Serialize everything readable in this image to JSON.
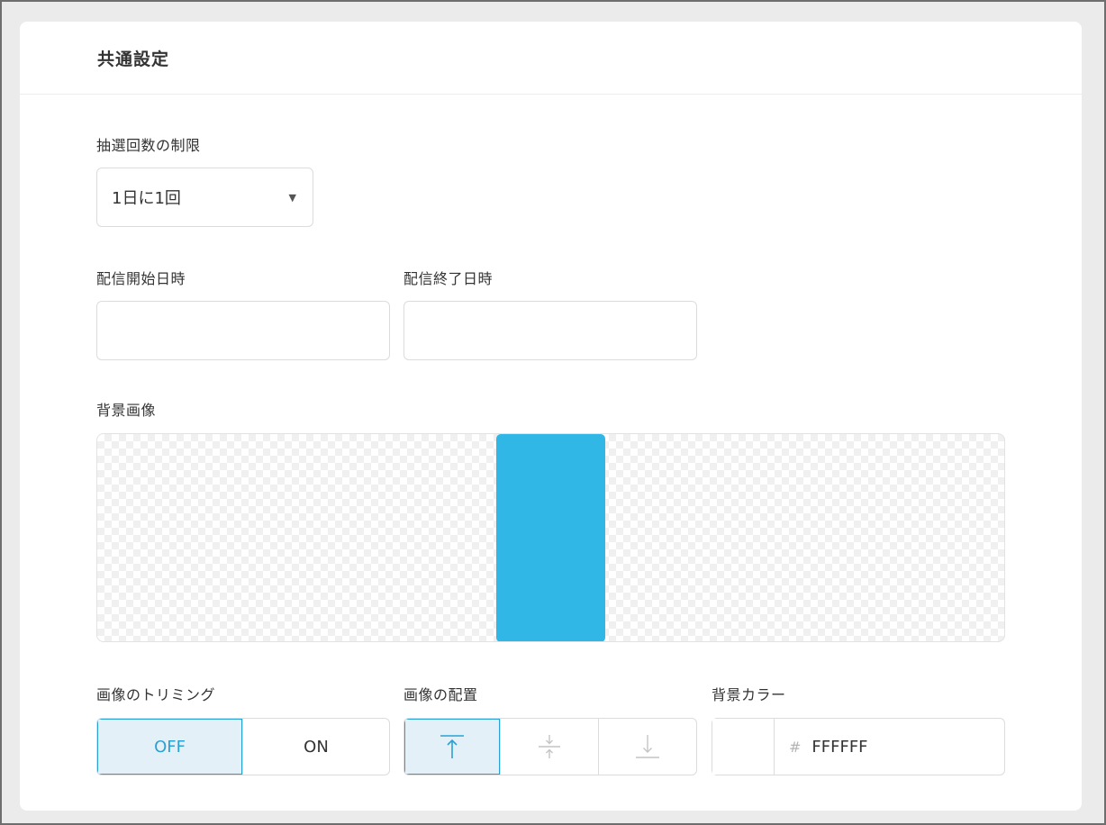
{
  "header": {
    "title": "共通設定"
  },
  "limit": {
    "label": "抽選回数の制限",
    "selected": "1日に1回",
    "caret": "▼"
  },
  "schedule": {
    "start_label": "配信開始日時",
    "start_value": "",
    "end_label": "配信終了日時",
    "end_value": ""
  },
  "background_image": {
    "label": "背景画像",
    "preview_color": "#31b7e6"
  },
  "trimming": {
    "label": "画像のトリミング",
    "options": [
      "OFF",
      "ON"
    ],
    "selected": "OFF"
  },
  "placement": {
    "label": "画像の配置",
    "options": [
      "align-top-icon",
      "align-middle-icon",
      "align-bottom-icon"
    ],
    "selected": "align-top-icon"
  },
  "background_color": {
    "label": "背景カラー",
    "hash": "#",
    "value": "FFFFFF",
    "swatch_color": "#FFFFFF"
  },
  "colors": {
    "accent": "#2aa1d3",
    "active_bg": "#e4f0f8"
  }
}
